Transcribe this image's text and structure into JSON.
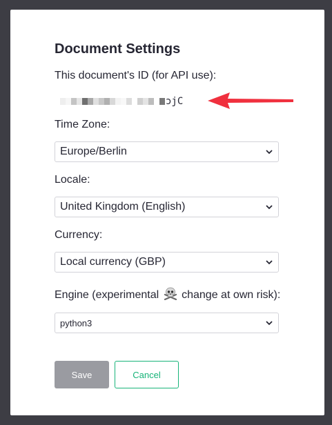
{
  "dialog": {
    "title": "Document Settings",
    "doc_id_label": "This document's ID (for API use):",
    "doc_id_visible_suffix": "ɔjC",
    "timezone_label": "Time Zone:",
    "timezone_value": "Europe/Berlin",
    "locale_label": "Locale:",
    "locale_value": "United Kingdom (English)",
    "currency_label": "Currency:",
    "currency_value": "Local currency (GBP)",
    "engine_label_prefix": "Engine (experimental",
    "engine_label_suffix": "change at own risk):",
    "engine_value": "python3",
    "save_label": "Save",
    "cancel_label": "Cancel"
  },
  "icons": {
    "warning": "skull-and-crossbones-icon",
    "annotation": "red-arrow-icon",
    "dropdown": "chevron-down-icon"
  },
  "colors": {
    "accent": "#16b378",
    "annotation_arrow": "#f0303e",
    "save_button": "#9a9ba1",
    "backdrop": "#3d3d44"
  }
}
